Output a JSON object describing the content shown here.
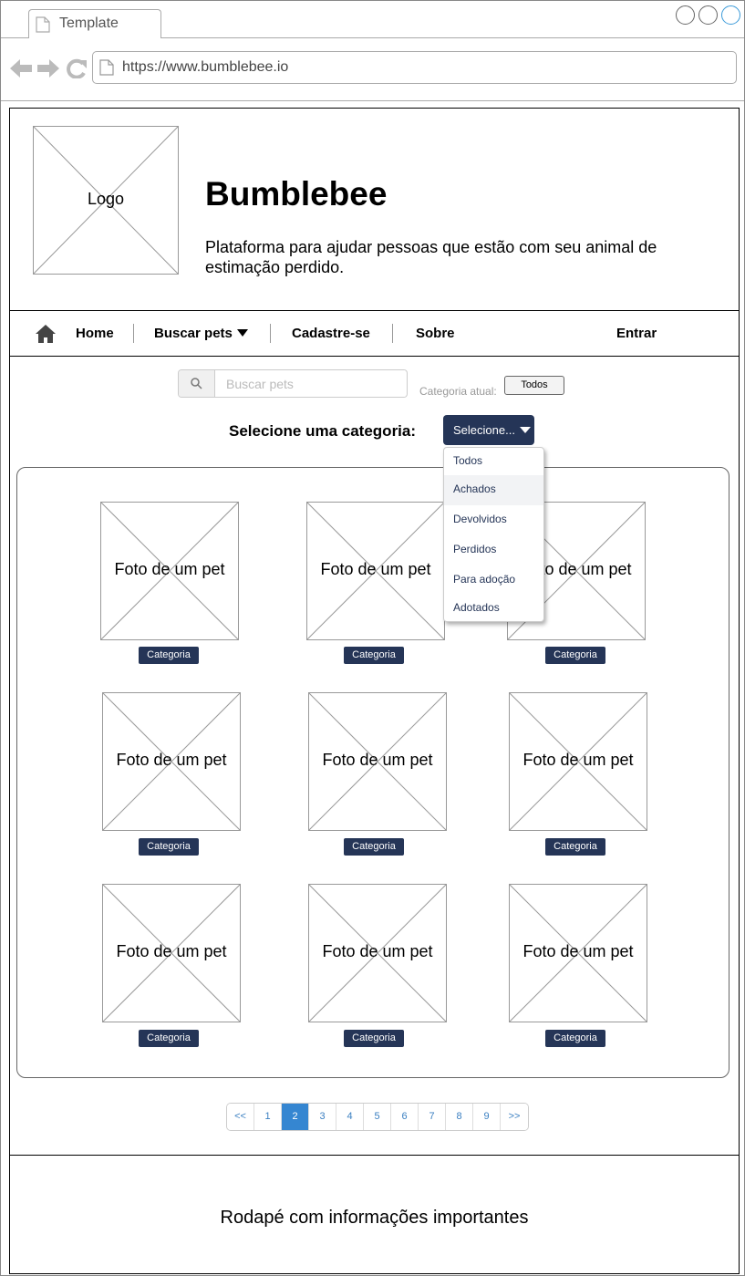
{
  "browser": {
    "tab_title": "Template",
    "url": "https://www.bumblebee.io"
  },
  "header": {
    "logo_label": "Logo",
    "title": "Bumblebee",
    "subtitle": "Plataforma para ajudar pessoas que estão com seu animal de estimação perdido."
  },
  "nav": {
    "home": "Home",
    "buscar": "Buscar pets",
    "cadastre": "Cadastre-se",
    "sobre": "Sobre",
    "entrar": "Entrar"
  },
  "search": {
    "placeholder": "Buscar pets",
    "current_category_label": "Categoria atual:",
    "current_category_value": "Todos"
  },
  "category_select": {
    "label": "Selecione uma categoria:",
    "button": "Selecione...",
    "options": [
      "Todos",
      "Achados",
      "Devolvidos",
      "Perdidos",
      "Para adoção",
      "Adotados"
    ],
    "hovered": "Achados"
  },
  "pets": [
    {
      "photo": "Foto de um pet",
      "category": "Categoria"
    },
    {
      "photo": "Foto de um pet",
      "category": "Categoria"
    },
    {
      "photo": "Foto de um pet",
      "category": "Categoria"
    },
    {
      "photo": "Foto de um pet",
      "category": "Categoria"
    },
    {
      "photo": "Foto de um pet",
      "category": "Categoria"
    },
    {
      "photo": "Foto de um pet",
      "category": "Categoria"
    },
    {
      "photo": "Foto de um pet",
      "category": "Categoria"
    },
    {
      "photo": "Foto de um pet",
      "category": "Categoria"
    },
    {
      "photo": "Foto de um pet",
      "category": "Categoria"
    }
  ],
  "pagination": {
    "items": [
      "<<",
      "1",
      "2",
      "3",
      "4",
      "5",
      "6",
      "7",
      "8",
      "9",
      ">>"
    ],
    "active": "2"
  },
  "footer": {
    "text": "Rodapé com informações importantes"
  }
}
